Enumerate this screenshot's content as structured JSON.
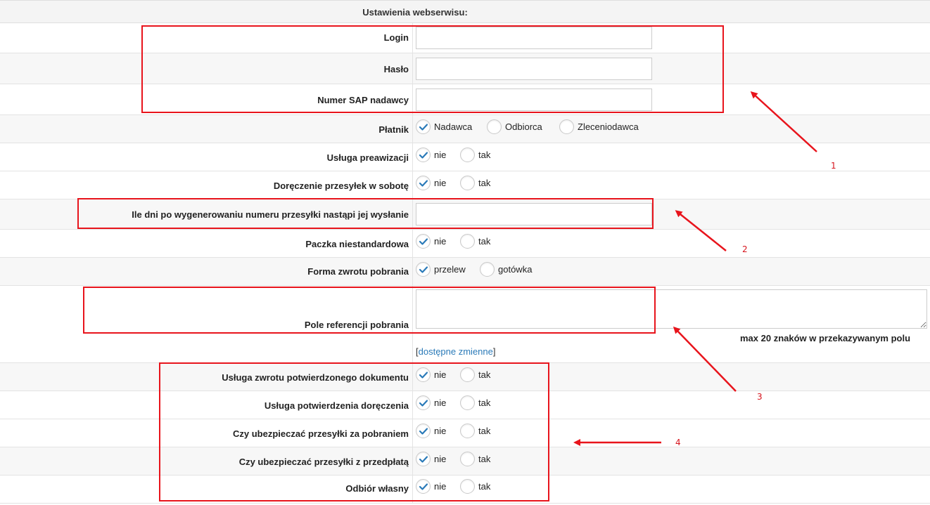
{
  "header": {
    "title": "Ustawienia webserwisu:"
  },
  "fields": {
    "login": {
      "label": "Login",
      "value": ""
    },
    "haslo": {
      "label": "Hasło",
      "value": ""
    },
    "sap": {
      "label": "Numer SAP nadawcy",
      "value": ""
    },
    "platnik": {
      "label": "Płatnik",
      "options": [
        "Nadawca",
        "Odbiorca",
        "Zleceniodawca"
      ],
      "selected": "Nadawca"
    },
    "preawizacja": {
      "label": "Usługa preawizacji",
      "options": [
        "nie",
        "tak"
      ],
      "selected": "nie"
    },
    "sobota": {
      "label": "Doręczenie przesyłek w sobotę",
      "options": [
        "nie",
        "tak"
      ],
      "selected": "nie"
    },
    "dni": {
      "label": "Ile dni po wygenerowaniu numeru przesyłki nastąpi jej wysłanie",
      "value": ""
    },
    "niestandardowa": {
      "label": "Paczka niestandardowa",
      "options": [
        "nie",
        "tak"
      ],
      "selected": "nie"
    },
    "forma_zwrotu": {
      "label": "Forma zwrotu pobrania",
      "options": [
        "przelew",
        "gotówka"
      ],
      "selected": "przelew"
    },
    "referencja": {
      "label": "Pole referencji pobrania",
      "value": "",
      "hint": "max 20 znaków w przekazywanym polu",
      "bracket_open": "[",
      "link": "dostępne zmienne",
      "bracket_close": "]"
    },
    "zwrot_dokumentu": {
      "label": "Usługa zwrotu potwierdzonego dokumentu",
      "options": [
        "nie",
        "tak"
      ],
      "selected": "nie"
    },
    "potw_doreczenia": {
      "label": "Usługa potwierdzenia doręczenia",
      "options": [
        "nie",
        "tak"
      ],
      "selected": "nie"
    },
    "ubezp_pobranie": {
      "label": "Czy ubezpieczać przesyłki za pobraniem",
      "options": [
        "nie",
        "tak"
      ],
      "selected": "nie"
    },
    "ubezp_przedplata": {
      "label": "Czy ubezpieczać przesyłki z przedpłatą",
      "options": [
        "nie",
        "tak"
      ],
      "selected": "nie"
    },
    "odbior_wlasny": {
      "label": "Odbiór własny",
      "options": [
        "nie",
        "tak"
      ],
      "selected": "nie"
    }
  },
  "annotations": {
    "n1": "1",
    "n2": "2",
    "n3": "3",
    "n4": "4",
    "color": "#e8141c"
  },
  "colors": {
    "accent_check": "#2a7ab8",
    "link": "#2a7ab8"
  }
}
